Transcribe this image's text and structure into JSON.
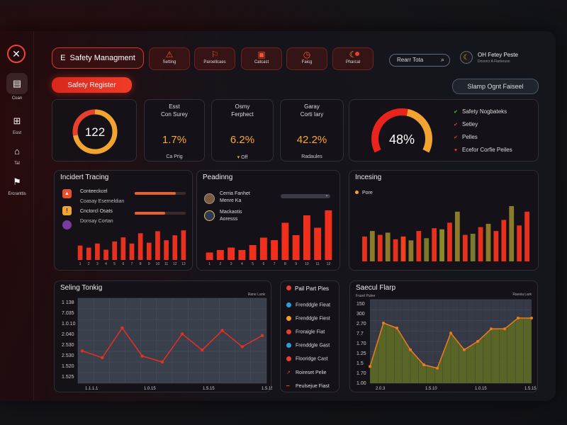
{
  "app": {
    "logo_icon": "tools-icon"
  },
  "sidebar": {
    "items": [
      {
        "label": "Coan",
        "icon": "folder-icon",
        "glyph": "▤"
      },
      {
        "label": "Eost",
        "icon": "grid-icon",
        "glyph": "⊞"
      },
      {
        "label": "Tal",
        "icon": "home-icon",
        "glyph": "⌂"
      },
      {
        "label": "Ercranttis",
        "icon": "bell-icon",
        "glyph": "⚑"
      }
    ]
  },
  "header": {
    "title": "Safety Managment",
    "title_icon": "E",
    "tools": [
      {
        "label": "Setting",
        "icon": "alert-icon",
        "glyph": "⚠"
      },
      {
        "label": "Paroellcaes",
        "icon": "flag-icon",
        "glyph": "⚐"
      },
      {
        "label": "Catcast",
        "icon": "briefcase-icon",
        "glyph": "▣"
      },
      {
        "label": "Faicg",
        "icon": "clock-icon",
        "glyph": "◷"
      },
      {
        "label": "Pharcal",
        "icon": "moon-icon",
        "glyph": "☾"
      }
    ],
    "search_placeholder": "Rearr Tota",
    "user_name": "OH Fetey Peste",
    "user_sub": "Dovorcr A Flarterusn",
    "register_button": "Safety Register",
    "report_button": "Slamp Ognt Faiseel"
  },
  "kpis": {
    "ring_value": "122",
    "ring_fraction": 0.72,
    "cards": [
      {
        "label_1": "Esst",
        "label_2": "Con Surey",
        "value": "1.7%",
        "foot": "Ca Prig"
      },
      {
        "label_1": "Osmy",
        "label_2": "Ferphect",
        "value": "6.2%",
        "foot": "Off"
      },
      {
        "label_1": "Garay",
        "label_2": "Corti Iary",
        "value": "42.2%",
        "foot": "Radaules"
      }
    ]
  },
  "gauge": {
    "value": "48%",
    "fraction": 0.48,
    "legend": [
      {
        "label": "Safety Nogbateks",
        "icon": "check-icon",
        "glyph": "✔",
        "color": "#3fc25a"
      },
      {
        "label": "Setley",
        "icon": "check-icon",
        "glyph": "✔",
        "color": "#e33b2f"
      },
      {
        "label": "Pelles",
        "icon": "check-icon",
        "glyph": "✔",
        "color": "#e33b2f"
      },
      {
        "label": "Ecefor Corfie Peiles",
        "icon": "heart-icon",
        "glyph": "♥",
        "color": "#e33b2f"
      }
    ]
  },
  "incident": {
    "title": "Incidert Tracing",
    "rows": [
      {
        "label": "Conteeckcel",
        "sub": "Coasay Esemeldian",
        "icon": "fire-icon",
        "glyph": "▲",
        "color": "#e84f2a",
        "progress": 0.8
      },
      {
        "label": "Cnctorcl Osats",
        "sub": "Donsay Cortan",
        "icon": "warning-icon",
        "glyph": "!",
        "color": "#f2a430",
        "progress": 0.6
      }
    ],
    "x_labels": [
      "1",
      "2",
      "3",
      "4",
      "5",
      "6",
      "7",
      "8",
      "9",
      "10",
      "11",
      "12",
      "13"
    ]
  },
  "ranking": {
    "title": "Peadinng",
    "rows": [
      {
        "label": "Cerria Fanhet",
        "sub": "Menre Ka"
      },
      {
        "label": "Mackaotis",
        "sub": "Aoresss"
      }
    ],
    "x_labels": [
      "1",
      "2",
      "3",
      "4",
      "5",
      "6",
      "7",
      "8",
      "9",
      "10",
      "11",
      "12"
    ]
  },
  "incoming": {
    "title": "Incesing",
    "legend": "Pore"
  },
  "trend": {
    "title": "Seling Tonkig",
    "corner": "Rane Lank",
    "y_labels": [
      "1 138",
      "7.035",
      "1.0.10",
      "2.040",
      "2.530",
      "2.530",
      "1.520",
      "1.525"
    ],
    "x_labels": [
      "1.1.1.1",
      "1.0.15",
      "1.5.15",
      "1.5.15"
    ]
  },
  "list": {
    "title": "Pail Part Pies",
    "items": [
      {
        "label": "Frenddgle Fieat",
        "color": "#2b9fd8",
        "icon": "circle-icon"
      },
      {
        "label": "Frenddgle Fiest",
        "color": "#f0a020",
        "icon": "circle-icon"
      },
      {
        "label": "Froraigle Fiat",
        "color": "#e8402c",
        "icon": "circle-icon"
      },
      {
        "label": "Frenddgle Gast",
        "color": "#2b9fd8",
        "icon": "circle-icon"
      },
      {
        "label": "Flooridge Cast",
        "color": "#e8402c",
        "icon": "circle-icon"
      },
      {
        "label": "Roireset Pelie",
        "color": "#e8402c",
        "icon": "spark-icon"
      },
      {
        "label": "Peulsejue Fiast",
        "color": "#e8402c",
        "icon": "dash-icon"
      }
    ]
  },
  "flow": {
    "title": "Saecul Flarp",
    "corner": "Raesia Lark",
    "sub": "Frarel Pulee",
    "y_labels": [
      "150",
      "300",
      "2.70",
      "7.7",
      "1.70",
      "1.25",
      "1.5",
      "1.70",
      "1.00"
    ],
    "x_labels": [
      "2.0.3",
      "1.5.10",
      "1.0.15",
      "1.5.15"
    ]
  },
  "chart_data": [
    {
      "type": "bar",
      "title": "Incidert Tracing",
      "categories": [
        "1",
        "2",
        "3",
        "4",
        "5",
        "6",
        "7",
        "8",
        "9",
        "10",
        "11",
        "12",
        "13"
      ],
      "values": [
        35,
        30,
        40,
        25,
        45,
        55,
        40,
        65,
        42,
        70,
        48,
        60,
        72
      ],
      "ylim": [
        0,
        100
      ]
    },
    {
      "type": "bar",
      "title": "Peadinng",
      "categories": [
        "1",
        "2",
        "3",
        "4",
        "5",
        "6",
        "7",
        "8",
        "9",
        "10",
        "11",
        "12"
      ],
      "values": [
        15,
        20,
        25,
        20,
        30,
        45,
        40,
        75,
        50,
        90,
        65,
        100
      ],
      "ylim": [
        0,
        100
      ]
    },
    {
      "type": "bar",
      "title": "Incesing",
      "series": [
        {
          "name": "Pore",
          "values": [
            45,
            55,
            48,
            52,
            40,
            45,
            38,
            55,
            42,
            60,
            58,
            70,
            90,
            48,
            50,
            62,
            68,
            55,
            75,
            100,
            65,
            90
          ]
        }
      ],
      "ylim": [
        0,
        100
      ]
    },
    {
      "type": "line",
      "title": "Seling Tonkig",
      "values": [
        38,
        30,
        65,
        32,
        25,
        58,
        39,
        62,
        43,
        56
      ],
      "ylim": [
        0,
        100
      ]
    },
    {
      "type": "area",
      "title": "Saecul Flarp",
      "values": [
        20,
        72,
        66,
        40,
        22,
        18,
        60,
        40,
        50,
        65,
        65,
        78,
        78
      ],
      "ylim": [
        0,
        100
      ]
    }
  ]
}
